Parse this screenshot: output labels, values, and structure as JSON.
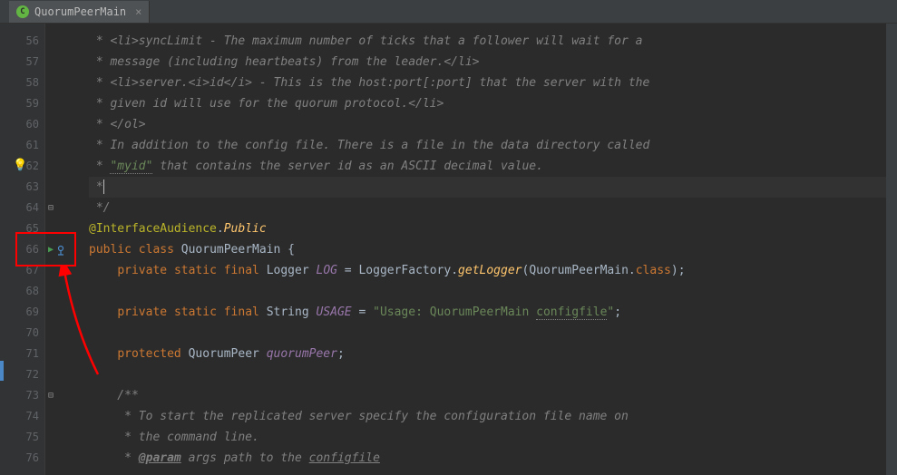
{
  "tab": {
    "label": "QuorumPeerMain",
    "icon_letter": "C"
  },
  "gutter": {
    "start": 56,
    "end": 76
  },
  "code": {
    "l56": " * <li>syncLimit - The maximum number of ticks that a follower will wait for a",
    "l57": " * message (including heartbeats) from the leader.</li>",
    "l58": " * <li>server.<i>id</i> - This is the host:port[:port] that the server with the",
    "l59": " * given id will use for the quorum protocol.</li>",
    "l60": " * </ol>",
    "l61": " * In addition to the config file. There is a file in the data directory called",
    "l62_a": " * ",
    "l62_b": "\"myid\"",
    "l62_c": " that contains the server id as an ASCII decimal value.",
    "l63": " *",
    "l64": " */",
    "l65_a": "@InterfaceAudience",
    "l65_b": ".",
    "l65_c": "Public",
    "l66_a": "public",
    "l66_b": " ",
    "l66_c": "class",
    "l66_d": " QuorumPeerMain {",
    "l67_a": "    ",
    "l67_b": "private",
    "l67_c": " ",
    "l67_d": "static",
    "l67_e": " ",
    "l67_f": "final",
    "l67_g": " Logger ",
    "l67_h": "LOG",
    "l67_i": " = LoggerFactory.",
    "l67_j": "getLogger",
    "l67_k": "(QuorumPeerMain.",
    "l67_l": "class",
    "l67_m": ");",
    "l69_a": "    ",
    "l69_b": "private",
    "l69_c": " ",
    "l69_d": "static",
    "l69_e": " ",
    "l69_f": "final",
    "l69_g": " String ",
    "l69_h": "USAGE",
    "l69_i": " = ",
    "l69_j": "\"Usage: QuorumPeerMain ",
    "l69_k": "configfile",
    "l69_l": "\"",
    "l69_m": ";",
    "l71_a": "    ",
    "l71_b": "protected",
    "l71_c": " QuorumPeer ",
    "l71_d": "quorumPeer",
    "l71_e": ";",
    "l73": "    /**",
    "l74": "     * To start the replicated server specify the configuration file name on",
    "l75": "     * the command line.",
    "l76_a": "     * ",
    "l76_b": "@param",
    "l76_c": " args path to the ",
    "l76_d": "configfile"
  }
}
